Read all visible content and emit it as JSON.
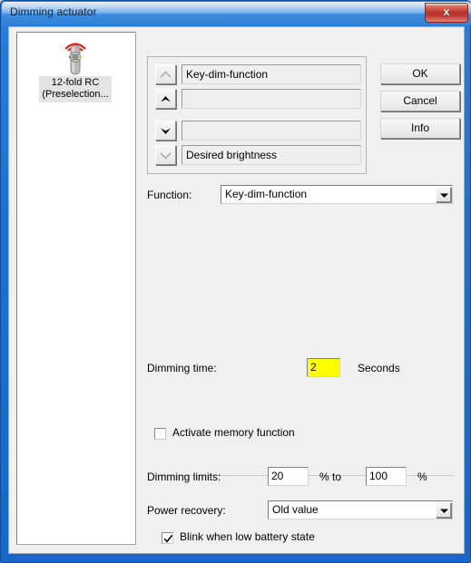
{
  "window": {
    "title": "Dimming actuator",
    "close_label": "x",
    "close_icon": "close-icon",
    "accent_color": "#2a7ddd",
    "client_bg": "#f0f0f0"
  },
  "tree": {
    "items": [
      {
        "icon": "remote-control-icon",
        "line1": "12-fold RC",
        "line2": "(Preselection...",
        "selected": true
      }
    ]
  },
  "buttons": {
    "ok": "OK",
    "cancel": "Cancel",
    "info": "Info"
  },
  "order_group": {
    "rows": [
      {
        "button_icon": "chevron-up-top-icon",
        "enabled": false,
        "value": "Key-dim-function"
      },
      {
        "button_icon": "chevron-up-icon",
        "enabled": true,
        "value": ""
      },
      {
        "button_icon": "chevron-down-icon",
        "enabled": true,
        "value": ""
      },
      {
        "button_icon": "chevron-down-bottom-icon",
        "enabled": false,
        "value": "Desired brightness"
      }
    ]
  },
  "form": {
    "function_label": "Function:",
    "function_value": "Key-dim-function",
    "dimming_time_label": "Dimming time:",
    "dimming_time_value": "2",
    "dimming_time_unit": "Seconds",
    "dimming_time_highlight_color": "#ffff00",
    "activate_memory_label": "Activate memory function",
    "activate_memory_checked": false,
    "dimming_limits_label": "Dimming limits:",
    "dimming_limit_min": "20",
    "dimming_limits_mid": "% to",
    "dimming_limit_max": "100",
    "dimming_limits_unit": "%",
    "power_recovery_label": "Power recovery:",
    "power_recovery_value": "Old value",
    "blink_low_battery_label": "Blink when low battery state",
    "blink_low_battery_checked": true
  }
}
